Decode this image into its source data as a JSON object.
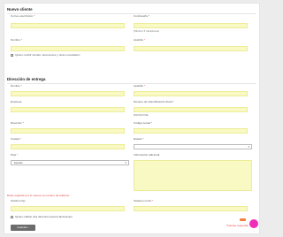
{
  "nuevo_cliente": {
    "title": "Nuevo cliente",
    "email_label": "Correo electrónico",
    "password_label": "Contraseña",
    "password_hint": "(Mínimo 5 caracteres)",
    "nombre_label": "Nombre",
    "apellido_label": "Apellido",
    "newsletter_label": "Quiero recibir ofertas, descuentos y otras novedades!",
    "newsletter_checked": true
  },
  "direccion": {
    "title": "Dirección de entrega",
    "nombre_label": "Nombre",
    "apellido_label": "Apellido",
    "empresa_label": "Empresa",
    "nif_label": "Número de indentificación fiscal",
    "nif_hint": "DNI/NIF/NIE",
    "direccion_label": "Dirección",
    "cp_label": "Código postal",
    "ciudad_label": "Ciudad",
    "estado_label": "Estado",
    "pais_label": "País",
    "pais_value": "España",
    "info_label": "Información adicional",
    "required_note": "Debe registrar por lo menos un número de teléfono",
    "telefono_fijo_label": "Teléfono fijo",
    "telefono_movil_label": "Teléfono móvil",
    "invoice_label": "Quiero utilizar otra dirección para la facturación",
    "invoice_checked": false,
    "required_fields_note": "*Campo requerido",
    "submit_label": "Guardar",
    "submit_arrow": "›"
  },
  "colors": {
    "input_bg": "#f9f9c4",
    "required": "#e23b3b",
    "button": "#6b6b6b",
    "fab": "#ef2db8"
  }
}
